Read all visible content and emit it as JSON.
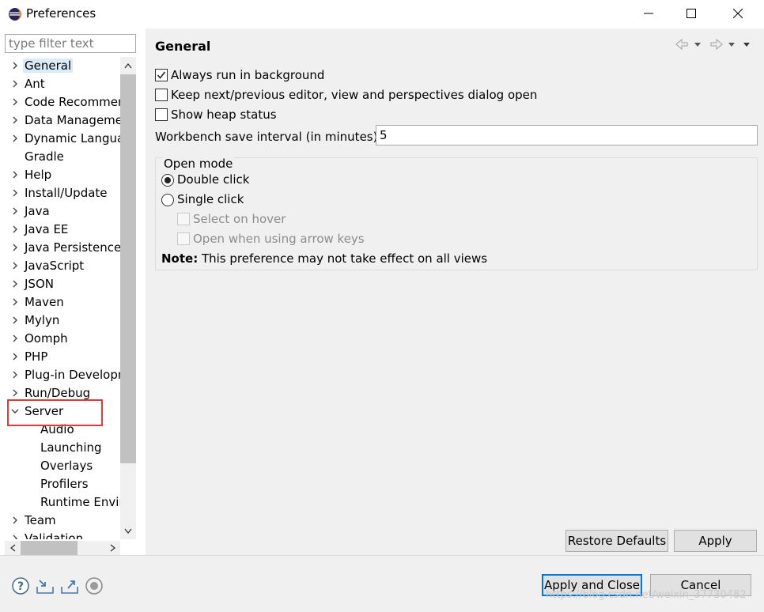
{
  "window": {
    "title": "Preferences"
  },
  "filter": {
    "placeholder": "type filter text"
  },
  "tree": {
    "items": [
      {
        "label": "General",
        "expandable": true,
        "selected": true
      },
      {
        "label": "Ant",
        "expandable": true
      },
      {
        "label": "Code Recommenders",
        "expandable": true
      },
      {
        "label": "Data Management",
        "expandable": true
      },
      {
        "label": "Dynamic Languages",
        "expandable": true
      },
      {
        "label": "Gradle",
        "expandable": false
      },
      {
        "label": "Help",
        "expandable": true
      },
      {
        "label": "Install/Update",
        "expandable": true
      },
      {
        "label": "Java",
        "expandable": true
      },
      {
        "label": "Java EE",
        "expandable": true
      },
      {
        "label": "Java Persistence",
        "expandable": true
      },
      {
        "label": "JavaScript",
        "expandable": true
      },
      {
        "label": "JSON",
        "expandable": true
      },
      {
        "label": "Maven",
        "expandable": true
      },
      {
        "label": "Mylyn",
        "expandable": true
      },
      {
        "label": "Oomph",
        "expandable": true
      },
      {
        "label": "PHP",
        "expandable": true
      },
      {
        "label": "Plug-in Development",
        "expandable": true
      },
      {
        "label": "Run/Debug",
        "expandable": true
      },
      {
        "label": "Server",
        "expandable": true,
        "expanded": true
      },
      {
        "label": "Audio",
        "child": true
      },
      {
        "label": "Launching",
        "child": true
      },
      {
        "label": "Overlays",
        "child": true
      },
      {
        "label": "Profilers",
        "child": true
      },
      {
        "label": "Runtime Environments",
        "child": true
      },
      {
        "label": "Team",
        "expandable": true
      },
      {
        "label": "Validation",
        "expandable": true
      }
    ]
  },
  "page": {
    "title": "General",
    "always_run_bg": {
      "label": "Always run in background",
      "checked": true
    },
    "keep_next_prev": {
      "label": "Keep next/previous editor, view and perspectives dialog open",
      "checked": false
    },
    "show_heap": {
      "label": "Show heap status",
      "checked": false
    },
    "save_interval": {
      "label": "Workbench save interval (in minutes):",
      "value": "5"
    },
    "open_mode": {
      "title": "Open mode",
      "double_click": {
        "label": "Double click",
        "selected": true
      },
      "single_click": {
        "label": "Single click",
        "selected": false
      },
      "select_on_hover": {
        "label": "Select on hover",
        "enabled": false
      },
      "open_arrow_keys": {
        "label": "Open when using arrow keys",
        "enabled": false
      },
      "note_bold": "Note:",
      "note_text": " This preference may not take effect on all views"
    },
    "restore_defaults": "Restore Defaults",
    "apply": "Apply"
  },
  "footer": {
    "apply_close": "Apply and Close",
    "cancel": "Cancel",
    "watermark": "https://blog.csdn.net/weixin_37730482"
  },
  "colors": {
    "selection": "#d9ebf9",
    "highlight_box": "#e53935",
    "default_button_border": "#0078d7"
  }
}
